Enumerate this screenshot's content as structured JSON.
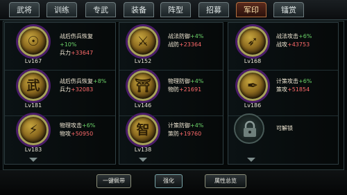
{
  "tabs": [
    "武将",
    "训练",
    "专武",
    "装备",
    "阵型",
    "招募",
    "军印",
    "镭赏"
  ],
  "seals": [
    {
      "level": "Lv167",
      "attr1": "战后伤兵恢复",
      "val1": "+10%",
      "attr2": "兵力",
      "val2": "+33647"
    },
    {
      "level": "Lv152",
      "attr1": "战法防御",
      "val1": "+4%",
      "attr2": "战防",
      "val2": "+23364"
    },
    {
      "level": "Lv168",
      "attr1": "战法攻击",
      "val1": "+6%",
      "attr2": "战攻",
      "val2": "+43753"
    },
    {
      "level": "Lv181",
      "attr1": "战后伤兵恢复",
      "val1": "+8%",
      "attr2": "兵力",
      "val2": "+32083"
    },
    {
      "level": "Lv146",
      "attr1": "物理防御",
      "val1": "+4%",
      "attr2": "物防",
      "val2": "+21691"
    },
    {
      "level": "Lv186",
      "attr1": "计策攻击",
      "val1": "+6%",
      "attr2": "策攻",
      "val2": "+51854"
    },
    {
      "level": "Lv183",
      "attr1": "物理攻击",
      "val1": "+6%",
      "attr2": "物攻",
      "val2": "+50950"
    },
    {
      "level": "Lv138",
      "attr1": "计策防御",
      "val1": "+4%",
      "attr2": "策防",
      "val2": "+19760"
    }
  ],
  "locked_text": "可解锁",
  "buttons": [
    "一键佩带",
    "强化",
    "属性总览"
  ],
  "colors": {
    "active_tab": "#b46f3f",
    "bonus_percent": "#6dd56a",
    "bonus_value": "#ff6b6b"
  }
}
